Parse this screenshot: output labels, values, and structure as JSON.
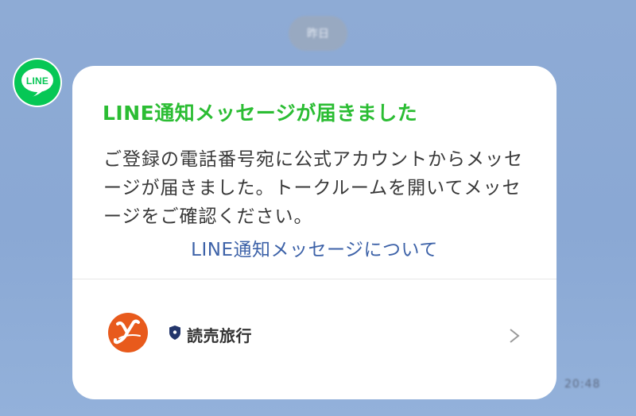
{
  "date_separator": "昨日",
  "sender": {
    "avatar_text": "LINE"
  },
  "message": {
    "title": "LINE通知メッセージが届きました",
    "body": "ご登録の電話番号宛に公式アカウントからメッセージが届きました。トークルームを開いてメッセージをご確認ください。",
    "link_label": "LINE通知メッセージについて",
    "title_color": "#2bbd33",
    "link_color": "#3d62a8"
  },
  "account": {
    "name": "読売旅行",
    "logo_icon": "yomiuri-ryoko-logo",
    "badge_icon": "verified-shield-icon",
    "chevron_icon": "chevron-right-icon"
  },
  "timestamp": "20:48",
  "colors": {
    "background": "#8eabd5",
    "line_green": "#06c755",
    "logo_orange": "#e85a1c"
  }
}
